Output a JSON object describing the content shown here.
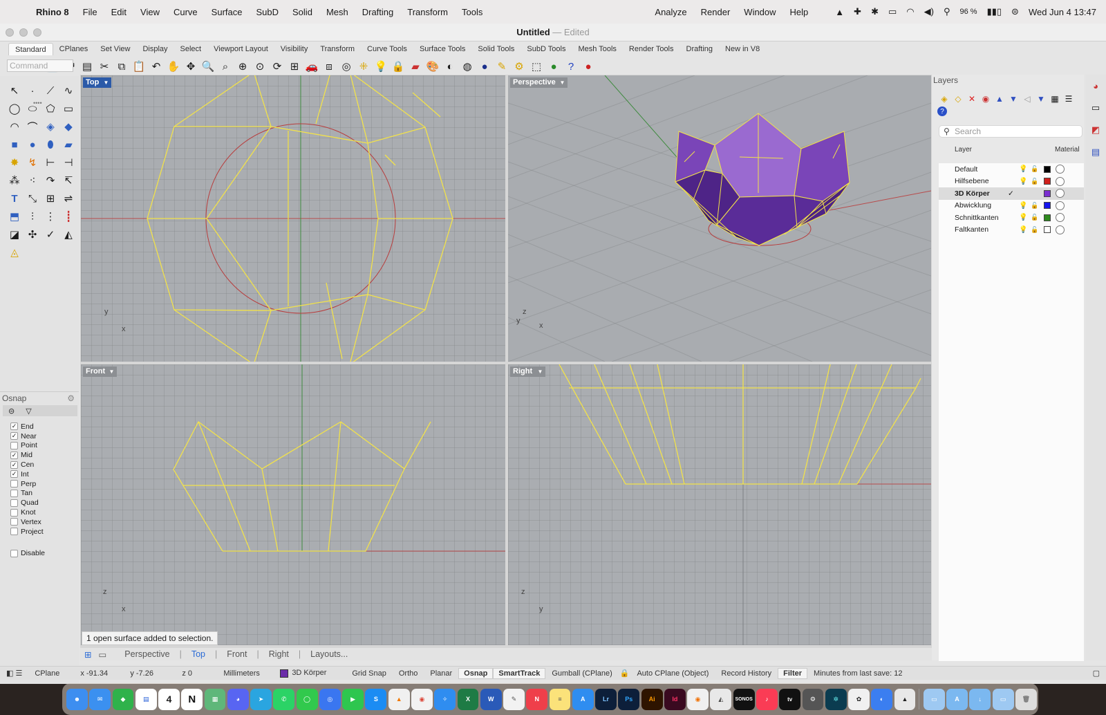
{
  "menubar": {
    "app": "Rhino 8",
    "items": [
      "File",
      "Edit",
      "View",
      "Curve",
      "Surface",
      "SubD",
      "Solid",
      "Mesh",
      "Drafting",
      "Transform",
      "Tools"
    ],
    "right_items": [
      "Analyze",
      "Render",
      "Window",
      "Help"
    ],
    "battery": "96 %",
    "datetime": "Wed Jun 4  13:47"
  },
  "window": {
    "title": "Untitled",
    "edited": "— Edited"
  },
  "tabs": [
    "Standard",
    "CPlanes",
    "Set View",
    "Display",
    "Select",
    "Viewport Layout",
    "Visibility",
    "Transform",
    "Curve Tools",
    "Surface Tools",
    "Solid Tools",
    "SubD Tools",
    "Mesh Tools",
    "Render Tools",
    "Drafting",
    "New in V8"
  ],
  "command": {
    "placeholder": "Command"
  },
  "osnap": {
    "title": "Osnap",
    "items": [
      {
        "label": "End",
        "checked": true
      },
      {
        "label": "Near",
        "checked": true
      },
      {
        "label": "Point",
        "checked": false
      },
      {
        "label": "Mid",
        "checked": true
      },
      {
        "label": "Cen",
        "checked": true
      },
      {
        "label": "Int",
        "checked": true
      },
      {
        "label": "Perp",
        "checked": false
      },
      {
        "label": "Tan",
        "checked": false
      },
      {
        "label": "Quad",
        "checked": false
      },
      {
        "label": "Knot",
        "checked": false
      },
      {
        "label": "Vertex",
        "checked": false
      },
      {
        "label": "Project",
        "checked": false
      }
    ],
    "disable": "Disable"
  },
  "viewports": {
    "top": "Top",
    "perspective": "Perspective",
    "front": "Front",
    "right": "Right",
    "axes": {
      "top": [
        "y",
        "x"
      ],
      "persp": [
        "z",
        "y",
        "x"
      ],
      "front": [
        "z",
        "x"
      ],
      "right": [
        "z",
        "y"
      ]
    }
  },
  "message": "1 open surface added to selection.",
  "viewtabs": [
    "Perspective",
    "Top",
    "Front",
    "Right",
    "Layouts..."
  ],
  "layers": {
    "title": "Layers",
    "search_placeholder": "Search",
    "col_layer": "Layer",
    "col_material": "Material",
    "rows": [
      {
        "name": "Default",
        "color": "#000000",
        "current": false
      },
      {
        "name": "Hilfsebene",
        "color": "#d0201c",
        "current": false
      },
      {
        "name": "3D Körper",
        "color": "#7b2fd0",
        "current": true
      },
      {
        "name": "Abwicklung",
        "color": "#1515ee",
        "current": false
      },
      {
        "name": "Schnittkanten",
        "color": "#2e8a1e",
        "current": false
      },
      {
        "name": "Faltkanten",
        "color": "#ffffff",
        "current": false
      }
    ]
  },
  "status": {
    "cplane": "CPlane",
    "x": "x -91.34",
    "y": "y -7.26",
    "z": "z 0",
    "units": "Millimeters",
    "layer": "3D Körper",
    "grid_snap": "Grid Snap",
    "ortho": "Ortho",
    "planar": "Planar",
    "osnap": "Osnap",
    "smarttrack": "SmartTrack",
    "gumball": "Gumball (CPlane)",
    "autocplane": "Auto CPlane (Object)",
    "record": "Record History",
    "filter": "Filter",
    "minutes": "Minutes from last save: 12"
  }
}
